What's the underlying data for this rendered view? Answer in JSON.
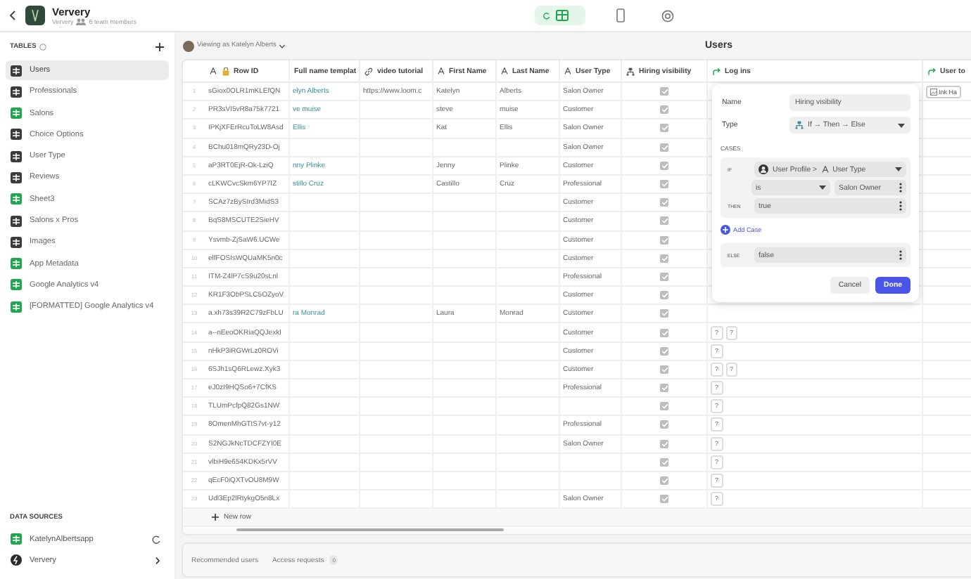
{
  "app": {
    "title": "Ververy",
    "subtitle": "Ververy",
    "members": "6 team members"
  },
  "modes": [
    {
      "kind": "data",
      "selected": true
    },
    {
      "kind": "layout",
      "selected": false
    },
    {
      "kind": "settings",
      "selected": false
    }
  ],
  "sidebar": {
    "tables_heading": "TABLES",
    "tables": [
      {
        "label": "Users",
        "kind": "table",
        "selected": true
      },
      {
        "label": "Professionals",
        "kind": "table",
        "selected": false
      },
      {
        "label": "Salons",
        "kind": "sheet",
        "selected": false
      },
      {
        "label": "Choice Options",
        "kind": "table",
        "selected": false
      },
      {
        "label": "User Type",
        "kind": "table",
        "selected": false
      },
      {
        "label": "Reviews",
        "kind": "table",
        "selected": false
      },
      {
        "label": "Sheet3",
        "kind": "sheet",
        "selected": false
      },
      {
        "label": "Salons x Pros",
        "kind": "table",
        "selected": false
      },
      {
        "label": "Images",
        "kind": "table",
        "selected": false
      },
      {
        "label": "App Metadata",
        "kind": "sheet",
        "selected": false
      },
      {
        "label": "Google Analytics v4",
        "kind": "sheet",
        "selected": false
      },
      {
        "label": "[FORMATTED] Google Analytics v4",
        "kind": "sheet",
        "selected": false
      }
    ],
    "sources_heading": "DATA SOURCES",
    "sources": [
      {
        "label": "KatelynAlbertsapp",
        "kind": "sheet"
      },
      {
        "label": "Ververy",
        "kind": "app"
      }
    ]
  },
  "view": {
    "viewing_as": "Viewing as Katelyn Alberts",
    "title": "Users"
  },
  "table": {
    "columns": [
      {
        "label": "Row ID",
        "kind": "rowid"
      },
      {
        "label": "Full name templat",
        "kind": "plain"
      },
      {
        "label": "video tutorial",
        "kind": "link"
      },
      {
        "label": "First Name",
        "kind": "text"
      },
      {
        "label": "Last Name",
        "kind": "text"
      },
      {
        "label": "User Type",
        "kind": "text"
      },
      {
        "label": "Hiring visibility",
        "kind": "ifelse"
      },
      {
        "label": "Log ins",
        "kind": "relation"
      },
      {
        "label": "User to",
        "kind": "relation"
      }
    ],
    "rows": [
      {
        "number": "1",
        "cells": [
          "sGiox0OLR1mKLEfQN",
          "elyn Alberts",
          "https://www.loom.c",
          "Katelyn",
          "Alberts",
          "Salon Owner"
        ],
        "checked": true,
        "log_ins": [],
        "user_to": "Ink Ha"
      },
      {
        "number": "2",
        "cells": [
          "PR3sVI5vR8a75k7721",
          "ve muise",
          "",
          "steve",
          "muise",
          "Customer"
        ],
        "checked": true,
        "log_ins": []
      },
      {
        "number": "3",
        "cells": [
          "IPKjXFErRcuToLW8Asd",
          "Ellis",
          "",
          "Kat",
          "Ellis",
          "Salon Owner"
        ],
        "checked": true,
        "log_ins": []
      },
      {
        "number": "4",
        "cells": [
          "BChu018mQRy23D-Oj",
          "",
          "",
          "",
          "",
          "Salon Owner"
        ],
        "checked": true,
        "log_ins": []
      },
      {
        "number": "5",
        "cells": [
          "aP3RT0EjR-Ok-LziQ",
          "nny Plinke",
          "",
          "Jenny",
          "Plinke",
          "Customer"
        ],
        "checked": true,
        "log_ins": []
      },
      {
        "number": "6",
        "cells": [
          "cLKWCvcSkm6YP7IZ",
          "stillo Cruz",
          "",
          "Castillo",
          "Cruz",
          "Professional"
        ],
        "checked": true,
        "log_ins": []
      },
      {
        "number": "7",
        "cells": [
          "SCAz7zBySIrd3MidS3",
          "",
          "",
          "",
          "",
          "Customer"
        ],
        "checked": true,
        "log_ins": []
      },
      {
        "number": "8",
        "cells": [
          "BqS8MSCUTE2SieHV",
          "",
          "",
          "",
          "",
          "Customer"
        ],
        "checked": true,
        "log_ins": []
      },
      {
        "number": "9",
        "cells": [
          "Ysvmb-ZjSaW6.UCWe",
          "",
          "",
          "",
          "",
          "Customer"
        ],
        "checked": true,
        "log_ins": []
      },
      {
        "number": "10",
        "cells": [
          "elfFOSIsWQUaMK5n0c",
          "",
          "",
          "",
          "",
          "Customer"
        ],
        "checked": true,
        "log_ins": []
      },
      {
        "number": "11",
        "cells": [
          "ITM-Z4lP7cS9u20sLnl",
          "",
          "",
          "",
          "",
          "Professional"
        ],
        "checked": true,
        "log_ins": []
      },
      {
        "number": "12",
        "cells": [
          "KR1F3ObPSLC5OZyoV",
          "",
          "",
          "",
          "",
          "Customer"
        ],
        "checked": true,
        "log_ins": []
      },
      {
        "number": "13",
        "cells": [
          "a.xh73s39R2C79zFbLU",
          "ra Monrad",
          "",
          "Laura",
          "Monrad",
          "Customer"
        ],
        "checked": true,
        "log_ins": []
      },
      {
        "number": "14",
        "cells": [
          "a--nEeoOKRiaQQJexkl",
          "",
          "",
          "",
          "",
          "Customer"
        ],
        "checked": true,
        "log_ins": [
          "?",
          "?"
        ]
      },
      {
        "number": "15",
        "cells": [
          "nHkP3iRGWrLz0ROVi",
          "",
          "",
          "",
          "",
          "Customer"
        ],
        "checked": true,
        "log_ins": [
          "?"
        ]
      },
      {
        "number": "16",
        "cells": [
          "6SJh1sQ6RLewz.Xyk3",
          "",
          "",
          "",
          "",
          "Customer"
        ],
        "checked": true,
        "log_ins": [
          "?",
          "?"
        ]
      },
      {
        "number": "17",
        "cells": [
          "eJ0zI9HQSo6+7CfKS",
          "",
          "",
          "",
          "",
          "Professional"
        ],
        "checked": true,
        "log_ins": [
          "?"
        ]
      },
      {
        "number": "18",
        "cells": [
          "TLUmPcfpQ82Gs1NW",
          "",
          "",
          "",
          "",
          ""
        ],
        "checked": true,
        "log_ins": [
          "?"
        ]
      },
      {
        "number": "19",
        "cells": [
          "8OmenMhGTtS7vt-y12",
          "",
          "",
          "",
          "",
          "Professional"
        ],
        "checked": true,
        "log_ins": [
          "?"
        ]
      },
      {
        "number": "20",
        "cells": [
          "S2NGJkNcTDCFZYI0E",
          "",
          "",
          "",
          "",
          "Salon Owner"
        ],
        "checked": true,
        "log_ins": [
          "?"
        ]
      },
      {
        "number": "21",
        "cells": [
          "vlbiH9e654KDKx5rVV",
          "",
          "",
          "",
          "",
          ""
        ],
        "checked": true,
        "log_ins": [
          "?"
        ]
      },
      {
        "number": "22",
        "cells": [
          "qEcF0iQXTvOU8M9W",
          "",
          "",
          "",
          "",
          ""
        ],
        "checked": true,
        "log_ins": [
          "?"
        ]
      },
      {
        "number": "23",
        "cells": [
          "Udl3Ep2lRtykgO5n8Lx",
          "",
          "",
          "",
          "",
          "Salon Owner"
        ],
        "checked": true,
        "log_ins": [
          "?"
        ]
      }
    ],
    "new_row": "New row"
  },
  "editor": {
    "name_label": "Name",
    "name_value": "Hiring visibility",
    "type_label": "Type",
    "type_value": "If → Then → Else",
    "cases_heading": "CASES",
    "cases": [
      {
        "if_label": "IF",
        "source": "User Profile >",
        "field": "User Type",
        "operator": "is",
        "value": "Salon Owner",
        "then_label": "THEN",
        "result": "true"
      }
    ],
    "add_case": "Add Case",
    "else_label": "ELSE",
    "else_value": "false",
    "buttons": [
      {
        "label": "Cancel",
        "kind": "secondary"
      },
      {
        "label": "Done",
        "kind": "primary"
      }
    ]
  },
  "bottom_tabs": [
    {
      "label": "Recommended users",
      "selected": false
    },
    {
      "label": "Access requests",
      "count": "0",
      "selected": false
    }
  ]
}
